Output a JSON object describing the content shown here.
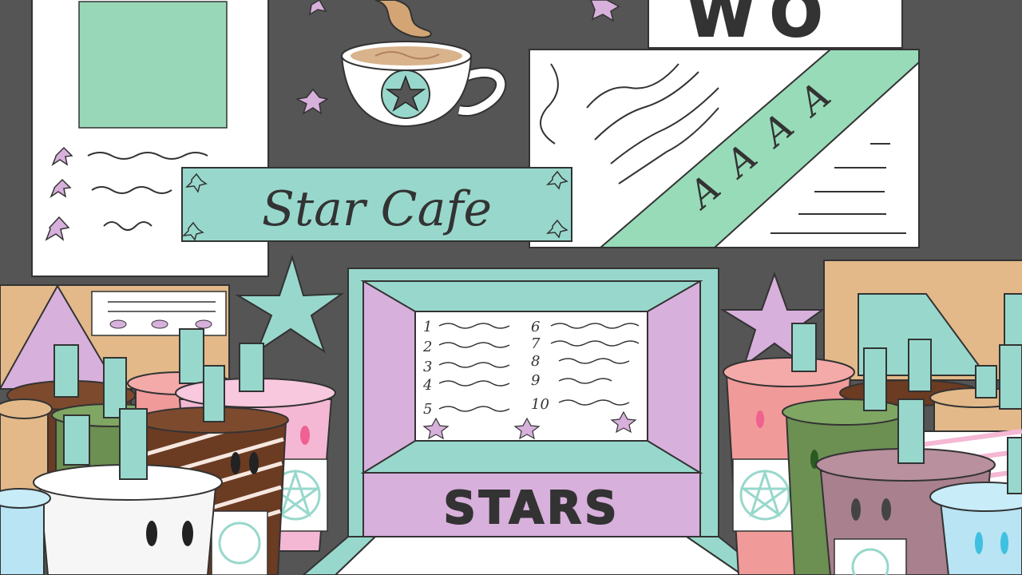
{
  "sign": {
    "title": "Star Cafe"
  },
  "wall_poster": {
    "letters": "WO"
  },
  "banner_text": [
    "A",
    "A",
    "A",
    "A"
  ],
  "menu": {
    "brand": "STARS",
    "numbers_left": [
      "1",
      "2",
      "3",
      "4",
      "5"
    ],
    "numbers_right": [
      "6",
      "7",
      "8",
      "9",
      "10"
    ]
  },
  "colors": {
    "wall": "#555555",
    "mint": "#98d8cc",
    "lilac": "#d8b0dc",
    "pink": "#f4b8d4",
    "tan": "#e3b98a",
    "coral": "#f09a9a",
    "coffee": "#6b3b22",
    "olive": "#6c8f52",
    "mauve": "#a8808e",
    "sky": "#b8e4f4"
  },
  "icons": [
    "star-icon",
    "coffee-cup-icon",
    "pentagram-icon",
    "steam-icon"
  ]
}
